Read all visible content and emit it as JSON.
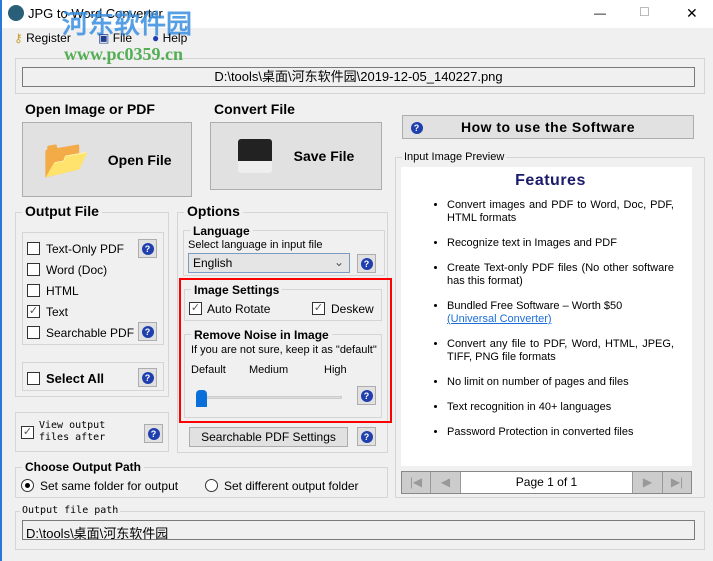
{
  "window": {
    "title": "JPG to Word Converter",
    "minimize": "—",
    "maximize": "☐",
    "close": "✕"
  },
  "watermark": {
    "text": "河东软件园",
    "url": "www.pc0359.cn"
  },
  "menu": [
    {
      "label": "Register",
      "icon": "key-icon"
    },
    {
      "label": "File",
      "icon": "floppy-icon"
    },
    {
      "label": "Help",
      "icon": "help-icon"
    }
  ],
  "input_path": "D:\\tools\\桌面\\河东软件园\\2019-12-05_140227.png",
  "open": {
    "group": "Open Image or PDF",
    "button": "Open File"
  },
  "convert": {
    "group": "Convert File",
    "button": "Save File"
  },
  "howto": "How to use the Software",
  "output_file": {
    "group": "Output File",
    "items": [
      {
        "label": "Text-Only PDF",
        "checked": false
      },
      {
        "label": "Word (Doc)",
        "checked": false
      },
      {
        "label": "HTML",
        "checked": false
      },
      {
        "label": "Text",
        "checked": true
      },
      {
        "label": "Searchable PDF",
        "checked": false
      }
    ],
    "select_all": "Select All",
    "view_after": "View output files after",
    "view_checked": true
  },
  "options": {
    "group": "Options",
    "language_group": "Language",
    "language_hint": "Select language in input file",
    "language_value": "English",
    "image_settings": "Image Settings",
    "auto_rotate": "Auto Rotate",
    "deskew": "Deskew",
    "noise_group": "Remove Noise in Image",
    "noise_hint": "If you are not sure, keep it as \"default\"",
    "levels": [
      "Default",
      "Medium",
      "High"
    ],
    "noise_level": 0,
    "pdf_settings": "Searchable PDF Settings"
  },
  "preview": {
    "group": "Input Image Preview",
    "heading": "Features",
    "features": [
      "Convert images and PDF to Word, Doc, PDF, HTML formats",
      "Recognize text in Images and PDF",
      "Create Text-only PDF files (No other software has this format)",
      "Bundled Free Software – Worth $50",
      "Convert any file to PDF, Word, HTML, JPEG, TIFF, PNG file formats",
      "No limit on number of pages and files",
      "Text recognition in 40+ languages",
      "Password Protection in converted files"
    ],
    "link": "(Universal Converter)",
    "page": "Page 1 of 1"
  },
  "output_path": {
    "group": "Choose Output Path",
    "same": "Set same folder for output",
    "different": "Set different output folder",
    "selected": "same",
    "path_label": "Output file path",
    "path": "D:\\tools\\桌面\\河东软件园"
  }
}
